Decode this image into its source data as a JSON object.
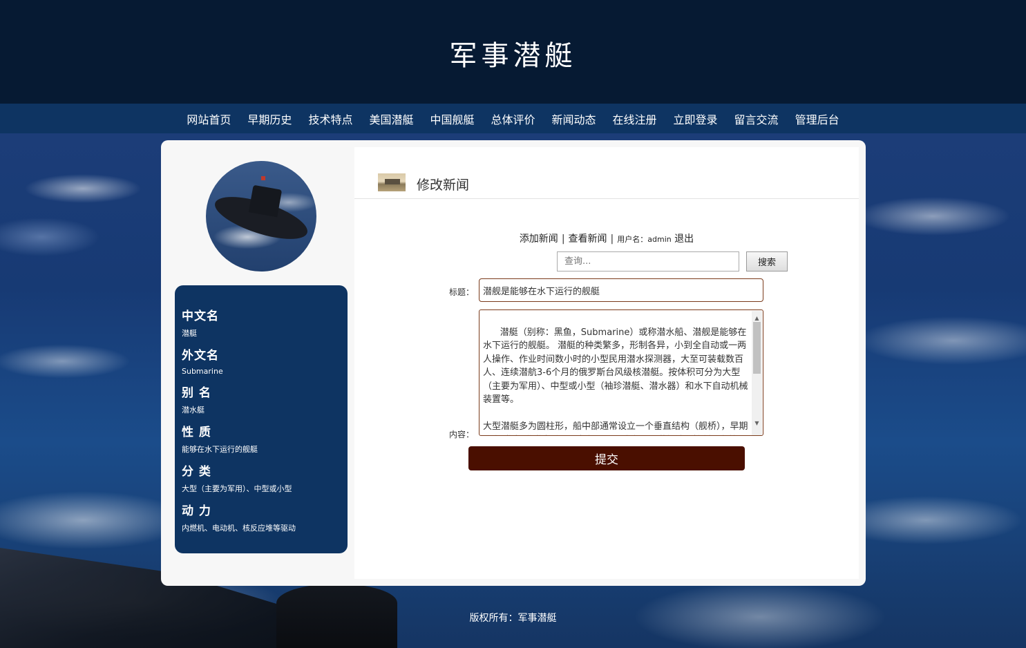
{
  "site": {
    "title": "军事潜艇"
  },
  "nav": {
    "items": [
      {
        "label": "网站首页"
      },
      {
        "label": "早期历史"
      },
      {
        "label": "技术特点"
      },
      {
        "label": "美国潜艇"
      },
      {
        "label": "中国舰艇"
      },
      {
        "label": "总体评价"
      },
      {
        "label": "新闻动态"
      },
      {
        "label": "在线注册"
      },
      {
        "label": "立即登录"
      },
      {
        "label": "留言交流"
      },
      {
        "label": "管理后台"
      }
    ]
  },
  "sidebar": {
    "info": [
      {
        "term": "中文名",
        "def": "潜艇"
      },
      {
        "term": "外文名",
        "def": "Submarine"
      },
      {
        "term": "别 名",
        "def": "潜水艇"
      },
      {
        "term": "性 质",
        "def": "能够在水下运行的舰艇"
      },
      {
        "term": "分 类",
        "def": "大型（主要为军用）、中型或小型"
      },
      {
        "term": "动 力",
        "def": "内燃机、电动机、核反应堆等驱动"
      }
    ]
  },
  "content": {
    "heading": "修改新闻",
    "links": {
      "add_news": "添加新闻",
      "view_news": "查看新闻",
      "separator": "|",
      "user_label": "用户名：admin",
      "logout": "退出"
    },
    "search": {
      "placeholder": "查询...",
      "button": "搜索"
    },
    "form": {
      "title_label": "标题：",
      "title_value": "潜舰是能够在水下运行的舰艇",
      "content_label": "内容：",
      "content_value": "潜艇（别称：黑鱼，Submarine）或称潜水船、潜舰是能够在水下运行的舰艇。 潜艇的种类繁多，形制各异，小到全自动或一两人操作、作业时间数小时的小型民用潜水探测器，大至可装载数百人、连续潜航3-6个月的俄罗斯台风级核潜艇。按体积可分为大型（主要为军用）、中型或小型（袖珍潜艇、潜水器）和水下自动机械装置等。\n\n大型潜艇多为圆柱形，船中部通常设立一个垂直结构（舰桥），早期称为“指挥塔/指挥台”，内有通讯、感应器、潜望镜和控制设备等，如今的深海潜艇或专业潜艇常已无此设计。",
      "submit": "提交"
    }
  },
  "footer": {
    "text": "版权所有：军事潜艇"
  }
}
